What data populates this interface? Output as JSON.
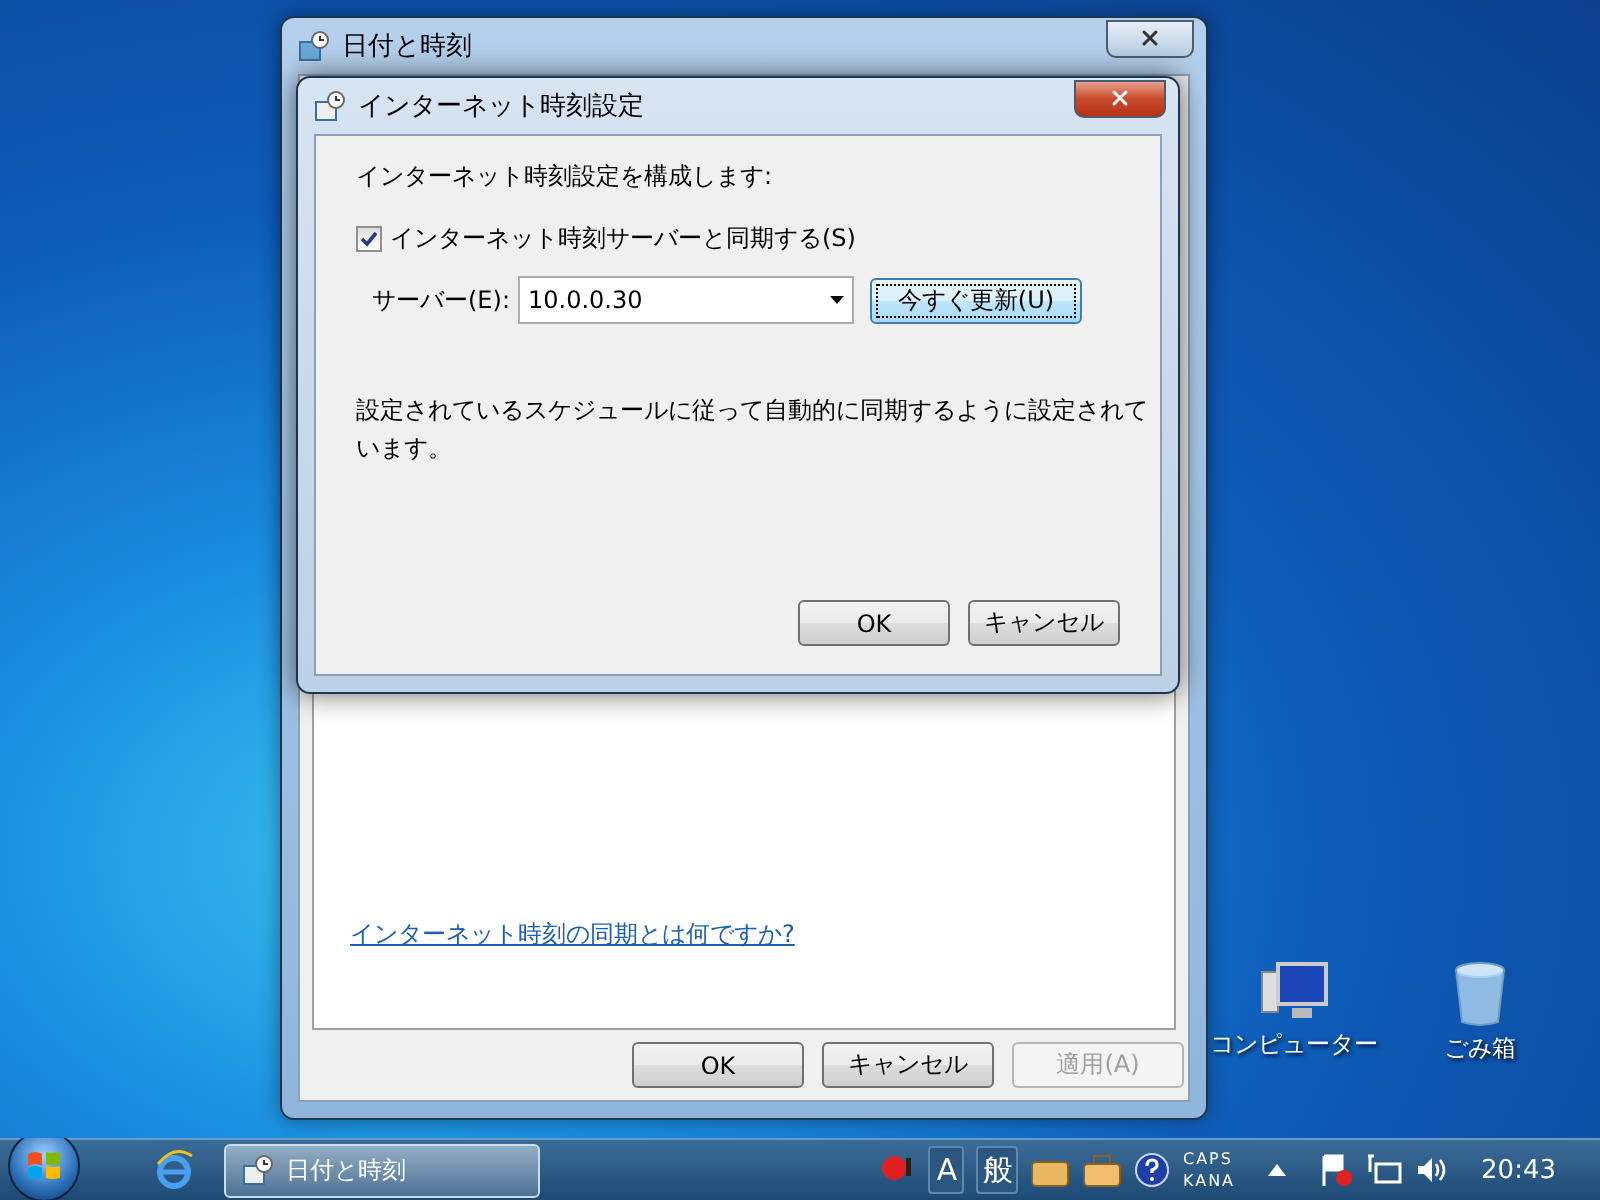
{
  "back_window": {
    "title": "日付と時刻",
    "link": "インターネット時刻の同期とは何ですか?",
    "buttons": [
      {
        "label": "OK",
        "disabled": false
      },
      {
        "label": "キャンセル",
        "disabled": false
      },
      {
        "label": "適用(A)",
        "disabled": true
      }
    ]
  },
  "dialog": {
    "title": "インターネット時刻設定",
    "heading": "インターネット時刻設定を構成します:",
    "sync_checkbox": {
      "label": "インターネット時刻サーバーと同期する(S)",
      "checked": true
    },
    "server": {
      "label": "サーバー(E):",
      "value": "10.0.0.30"
    },
    "update_button": "今すぐ更新(U)",
    "status": "設定されているスケジュールに従って自動的に同期するように設定されています。",
    "buttons": [
      "OK",
      "キャンセル"
    ]
  },
  "desktop_icons": [
    {
      "label": "コンピューター",
      "kind": "computer"
    },
    {
      "label": "ごみ箱",
      "kind": "trash"
    }
  ],
  "taskbar": {
    "task": "日付と時刻",
    "ime": [
      "A",
      "般"
    ],
    "caps": "CAPS",
    "kana": "KANA",
    "clock": "20:43"
  }
}
